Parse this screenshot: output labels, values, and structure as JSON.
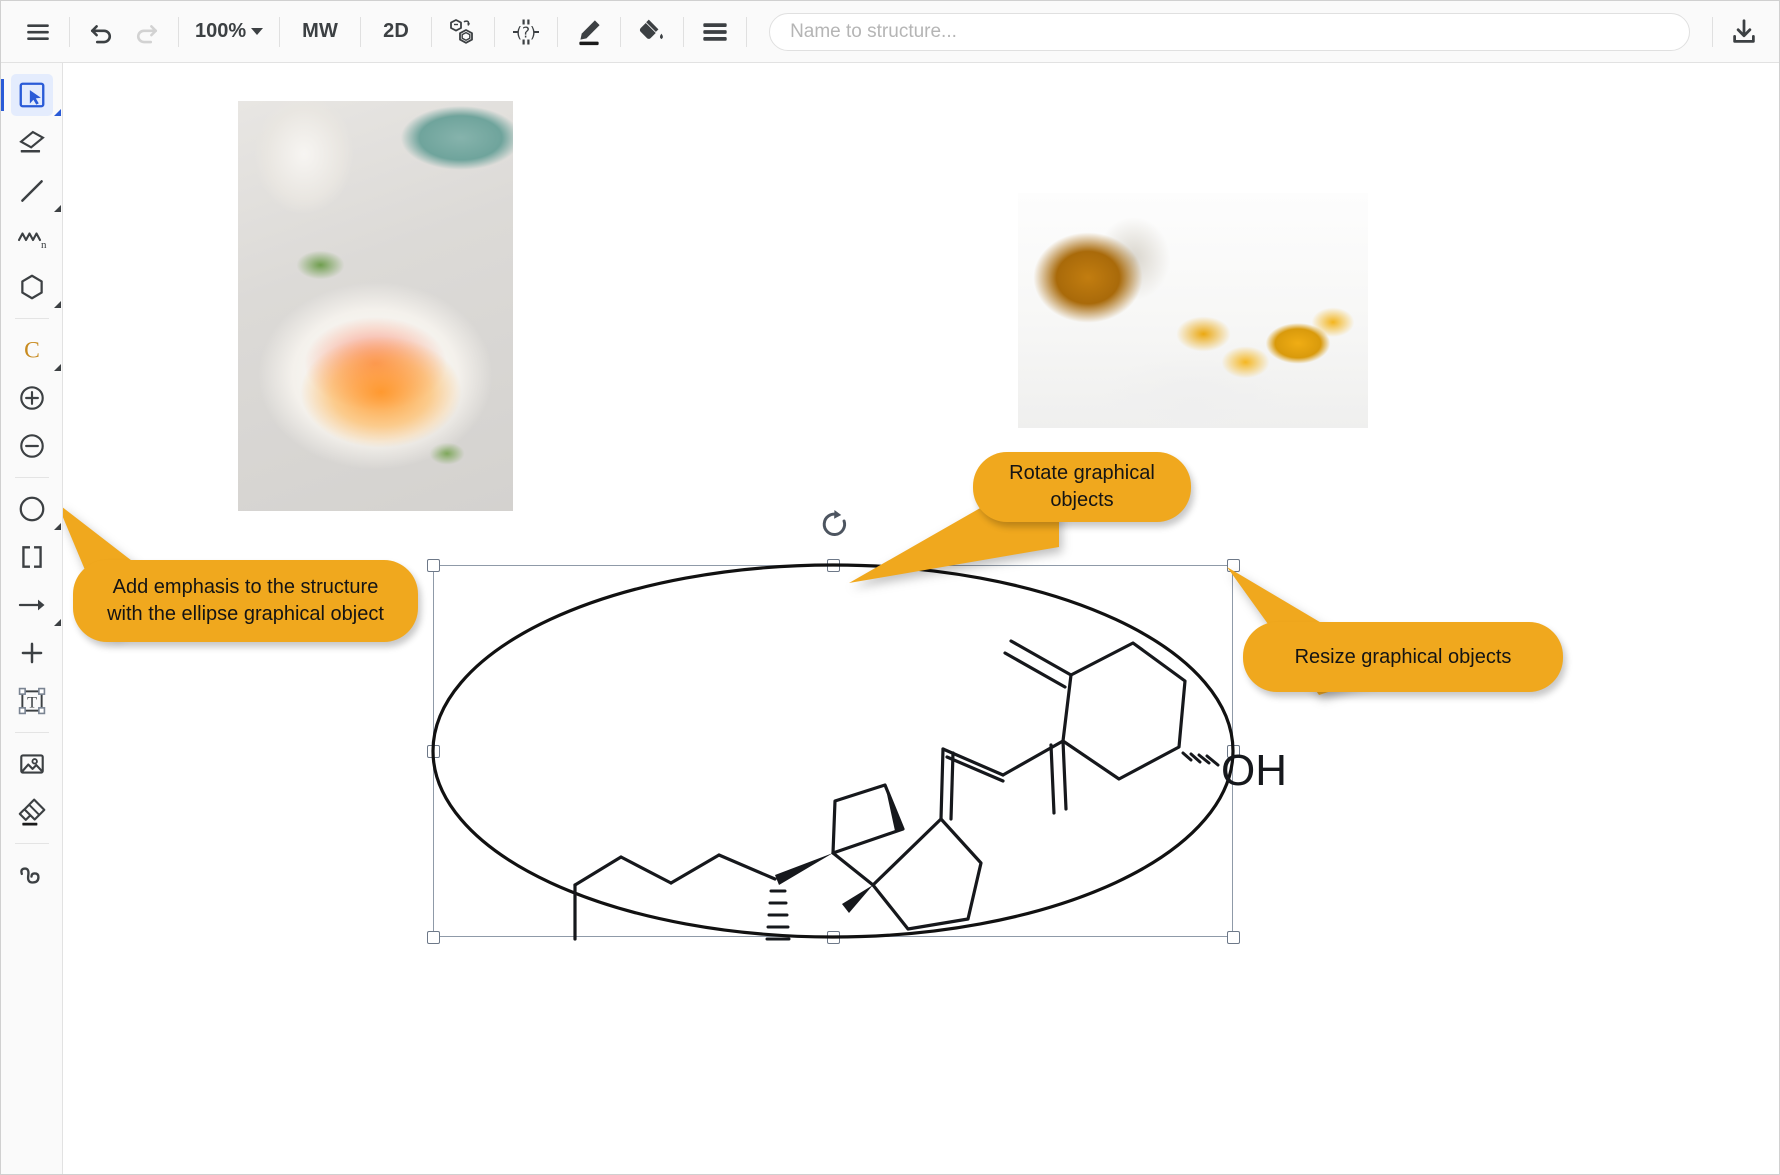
{
  "app": {
    "title": "Chemical structure editor canvas"
  },
  "toolbar": {
    "menu_label": "Menu",
    "undo_label": "Undo",
    "redo_label": "Redo",
    "zoom_level": "100%",
    "mw_label": "MW",
    "dimension_label": "2D",
    "structure_tools_label": "Structure templates",
    "query_label": "Query properties",
    "pen_label": "Pen color",
    "fill_label": "Fill color",
    "lines_label": "Line style",
    "download_label": "Download",
    "name_to_structure": {
      "value": "",
      "placeholder": "Name to structure..."
    }
  },
  "sidebar": {
    "items": [
      {
        "id": "select",
        "label": "Select",
        "icon": "select-arrow-icon",
        "active": true,
        "has_flyout": true
      },
      {
        "id": "erase",
        "label": "Erase",
        "icon": "eraser-icon",
        "active": false,
        "has_flyout": false
      },
      {
        "id": "bond",
        "label": "Draw bond",
        "icon": "line-icon",
        "active": false,
        "has_flyout": true
      },
      {
        "id": "chain",
        "label": "Repeating chain",
        "icon": "chain-n-icon",
        "active": false,
        "has_flyout": false
      },
      {
        "id": "ring",
        "label": "Ring template",
        "icon": "hexagon-icon",
        "active": false,
        "has_flyout": true
      },
      {
        "id": "atom",
        "label": "Carbon atom",
        "icon": "atom-c-icon",
        "active": false,
        "has_flyout": true
      },
      {
        "id": "charge-plus",
        "label": "Increase charge",
        "icon": "plus-circle-icon",
        "active": false,
        "has_flyout": false
      },
      {
        "id": "charge-minus",
        "label": "Decrease charge",
        "icon": "minus-circle-icon",
        "active": false,
        "has_flyout": false
      },
      {
        "id": "ellipse",
        "label": "Ellipse",
        "icon": "circle-icon",
        "active": false,
        "has_flyout": true
      },
      {
        "id": "brackets",
        "label": "Brackets",
        "icon": "brackets-icon",
        "active": false,
        "has_flyout": false
      },
      {
        "id": "arrow",
        "label": "Reaction arrow",
        "icon": "arrow-right-icon",
        "active": false,
        "has_flyout": true
      },
      {
        "id": "plus",
        "label": "Reaction plus",
        "icon": "plus-icon",
        "active": false,
        "has_flyout": false
      },
      {
        "id": "text",
        "label": "Text box",
        "icon": "text-box-icon",
        "active": false,
        "has_flyout": false
      },
      {
        "id": "image",
        "label": "Insert image",
        "icon": "image-icon",
        "active": false,
        "has_flyout": false
      },
      {
        "id": "highlight",
        "label": "Highlight",
        "icon": "marker-icon",
        "active": false,
        "has_flyout": false
      },
      {
        "id": "lasso",
        "label": "Freehand lasso",
        "icon": "squiggle-icon",
        "active": false,
        "has_flyout": false
      }
    ]
  },
  "canvas": {
    "images": [
      {
        "id": "food-photo",
        "alt": "Plate of avocado and salmon toast with poached egg"
      },
      {
        "id": "pills-photo",
        "alt": "Spilled bottle of amber vitamin D softgel capsules"
      }
    ],
    "structure": {
      "name": "Cholecalciferol (vitamin D3)",
      "labels": [
        "OH"
      ],
      "selected": true
    }
  },
  "callouts": [
    {
      "id": "ellipse-callout",
      "text": "Add emphasis to the structure with the ellipse graphical object"
    },
    {
      "id": "rotate-callout",
      "text": "Rotate graphical objects"
    },
    {
      "id": "resize-callout",
      "text": "Resize graphical objects"
    }
  ],
  "colors": {
    "accent": "#f0a81e",
    "active": "#2a5bd7",
    "selection": "#8f9aa8",
    "text": "#3c4043"
  }
}
